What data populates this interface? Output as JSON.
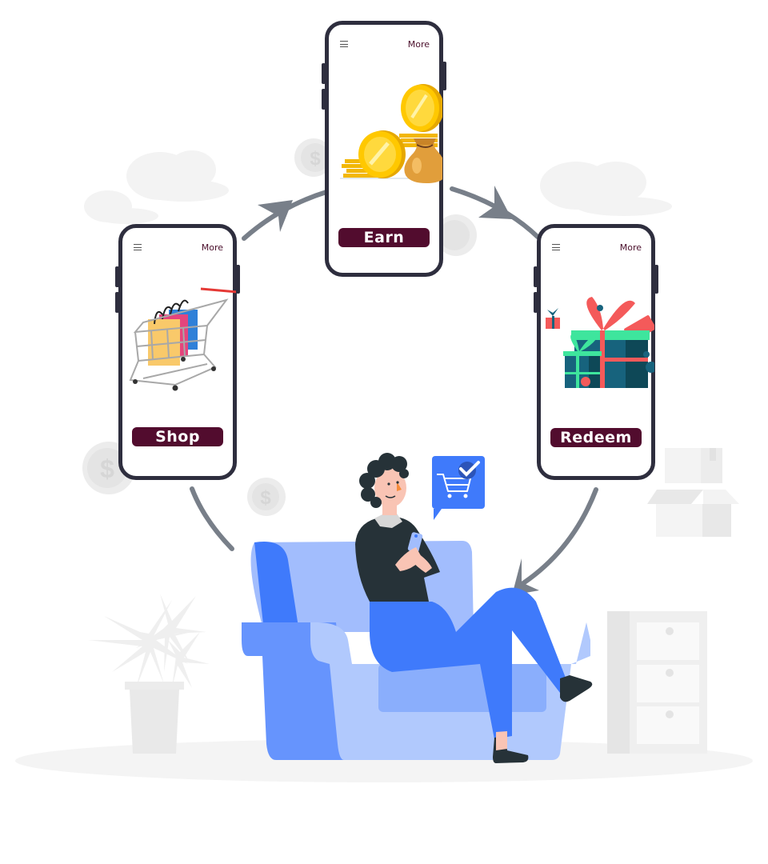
{
  "illustration": {
    "title": "Shop, Earn, Redeem loyalty cycle",
    "cycle_order": [
      "Shop",
      "Earn",
      "Redeem"
    ]
  },
  "phones": {
    "earn": {
      "menu_icon": "hamburger-icon",
      "more_label": "More",
      "cta_label": "Earn",
      "art": "coins-and-money-bag"
    },
    "shop": {
      "menu_icon": "hamburger-icon",
      "more_label": "More",
      "cta_label": "Shop",
      "art": "shopping-cart-with-bags"
    },
    "redeem": {
      "menu_icon": "hamburger-icon",
      "more_label": "More",
      "cta_label": "Redeem",
      "art": "gift-boxes"
    }
  },
  "speech_bubble": {
    "icon": "cart-check-icon"
  },
  "colors": {
    "cta_background": "#520c2e",
    "more_text": "#4a0e2b",
    "phone_frame": "#2e2e3e",
    "arrow": "#787f89",
    "sofa_dark": "#6694fd",
    "sofa_light": "#b1c9fd",
    "accent_blue": "#3f7afb",
    "background_props": "#f0f0f0"
  }
}
